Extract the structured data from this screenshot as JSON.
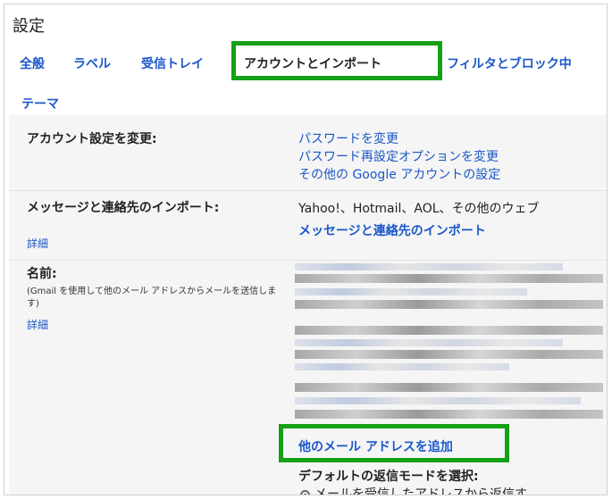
{
  "page": {
    "title": "設定"
  },
  "tabs": [
    {
      "label": "全般"
    },
    {
      "label": "ラベル"
    },
    {
      "label": "受信トレイ"
    },
    {
      "label": "アカウントとインポート",
      "active": true
    },
    {
      "label": "フィルタとブロック中"
    },
    {
      "label": "テーマ"
    }
  ],
  "account": {
    "label": "アカウント設定を変更:",
    "links": [
      "パスワードを変更",
      "パスワード再設定オプションを変更",
      "その他の Google アカウントの設定"
    ]
  },
  "import": {
    "label": "メッセージと連絡先のインポート:",
    "details_link": "詳細",
    "description": "Yahoo!、Hotmail、AOL、その他のウェブ",
    "action_link": "メッセージと連絡先のインポート"
  },
  "name": {
    "label": "名前:",
    "sub": "(Gmail を使用して他のメール アドレスからメールを送信します)",
    "details_link": "詳細",
    "add_address_link": "他のメール アドレスを追加",
    "reply_mode_label": "デフォルトの返信モードを選択:",
    "reply_option": "メールを受信したアドレスから返信す"
  },
  "colors": {
    "link": "#1a57c8",
    "highlight": "#15a015",
    "panel_bg": "#f5f5f5"
  }
}
